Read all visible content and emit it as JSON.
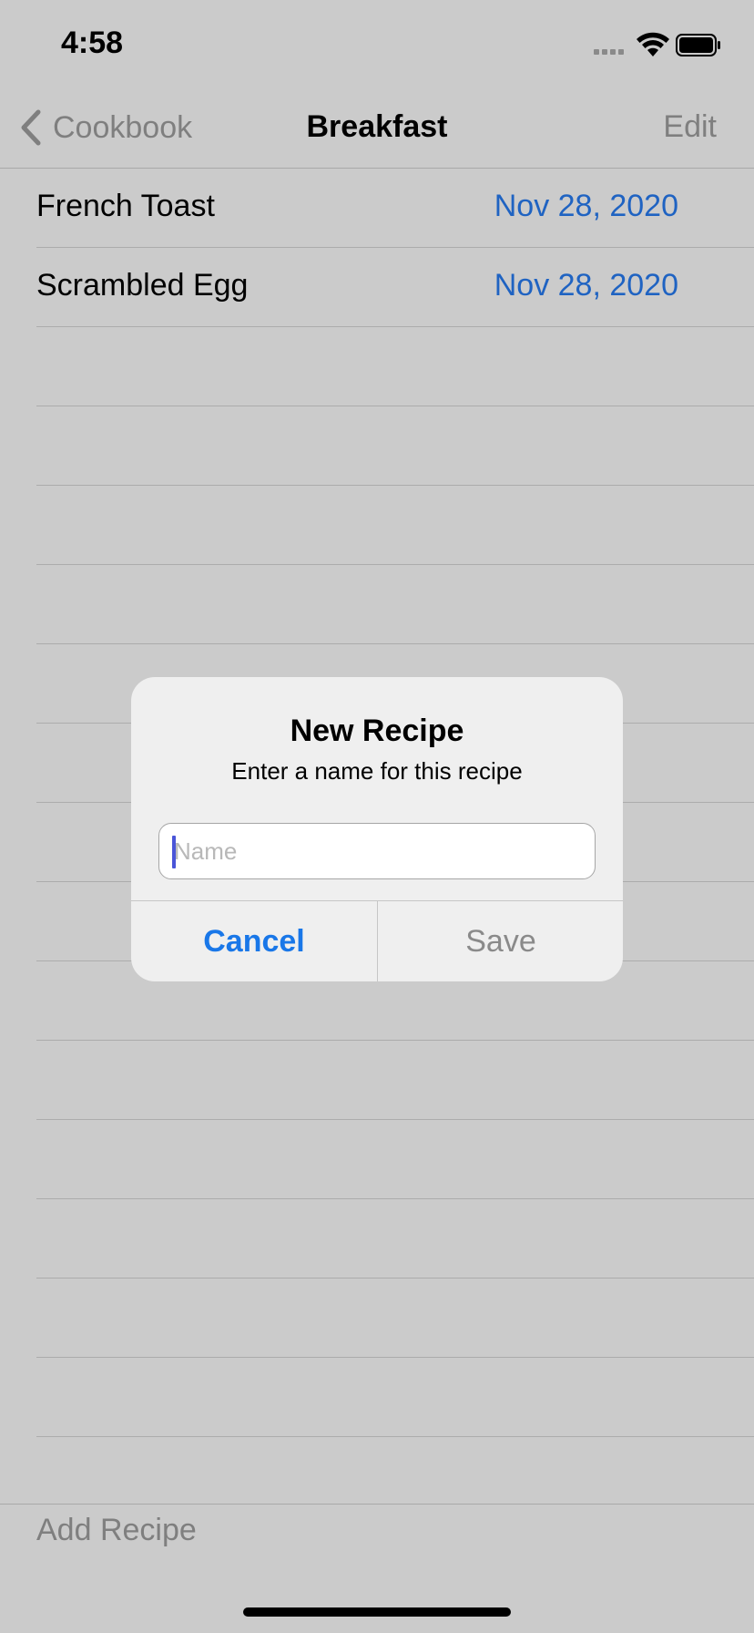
{
  "status_bar": {
    "time": "4:58"
  },
  "nav": {
    "back_label": "Cookbook",
    "title": "Breakfast",
    "edit_label": "Edit"
  },
  "recipes": [
    {
      "name": "French Toast",
      "date": "Nov 28, 2020"
    },
    {
      "name": "Scrambled Egg",
      "date": "Nov 28, 2020"
    }
  ],
  "toolbar": {
    "add_label": "Add Recipe"
  },
  "alert": {
    "title": "New Recipe",
    "message": "Enter a name for this recipe",
    "field_placeholder": "Name",
    "field_value": "",
    "cancel_label": "Cancel",
    "save_label": "Save"
  },
  "colors": {
    "accent": "#1977e8",
    "date_text": "#1f63c2",
    "dimmed_background": "#cbcbcb",
    "alert_background": "#efefef"
  },
  "icons": {
    "back": "chevron-left-icon",
    "wifi": "wifi-icon",
    "battery": "battery-icon",
    "signal": "cellular-signal-icon"
  }
}
